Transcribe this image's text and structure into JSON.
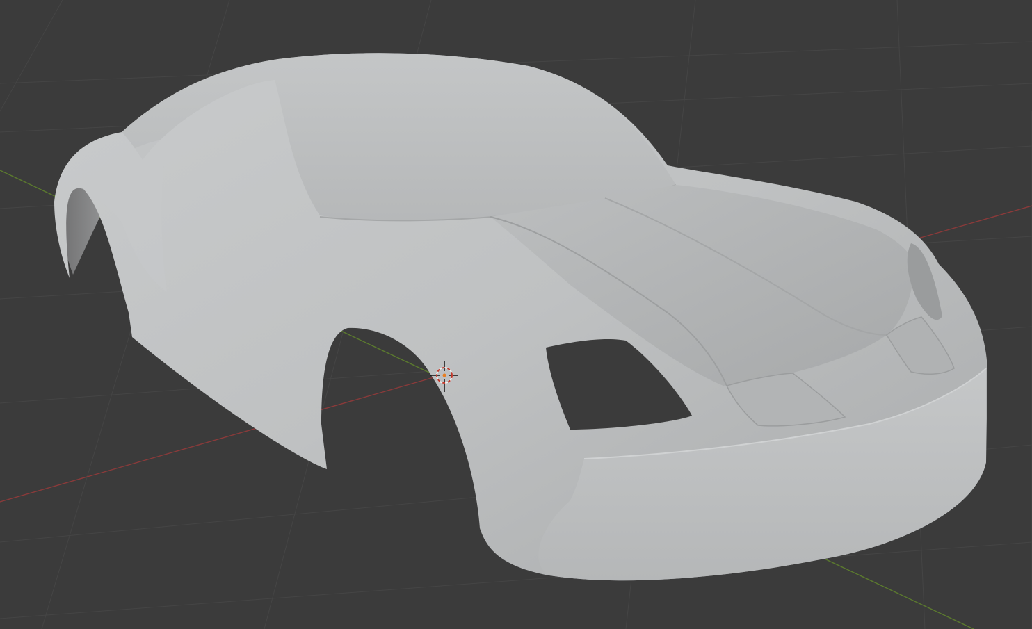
{
  "viewport": {
    "background_color": "#3b3b3b",
    "grid_line_color": "#454545",
    "x_axis_color": "#8a3a3a",
    "y_axis_color": "#5b7a2e",
    "object": {
      "type": "car-body-mesh",
      "surface_color": "#bcbebf",
      "shading": "solid"
    },
    "cursor_3d": {
      "icon": "crosshair-3d-cursor-icon",
      "ring_colors": [
        "#c0392b",
        "#f0f0f0"
      ]
    }
  }
}
